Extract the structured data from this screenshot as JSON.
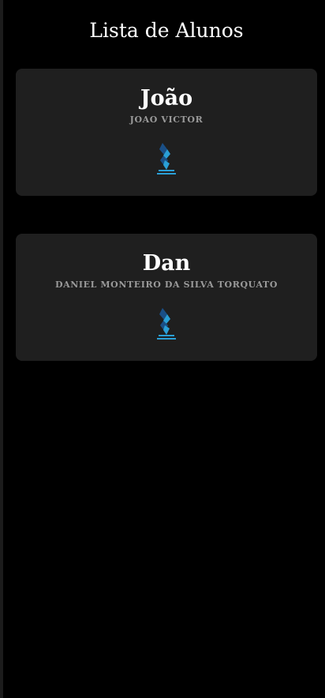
{
  "header": {
    "title": "Lista de Alunos"
  },
  "students": [
    {
      "name": "João",
      "full_name": "JOAO VICTOR",
      "logo_icon": "student-logo-icon"
    },
    {
      "name": "Dan",
      "full_name": "DANIEL MONTEIRO DA SILVA TORQUATO",
      "logo_icon": "student-logo-icon"
    }
  ],
  "colors": {
    "background": "#000000",
    "card": "#1f1f1f",
    "title": "#ffffff",
    "subtitle": "#9a9a9a",
    "logo_accent": "#2a9fd6"
  }
}
